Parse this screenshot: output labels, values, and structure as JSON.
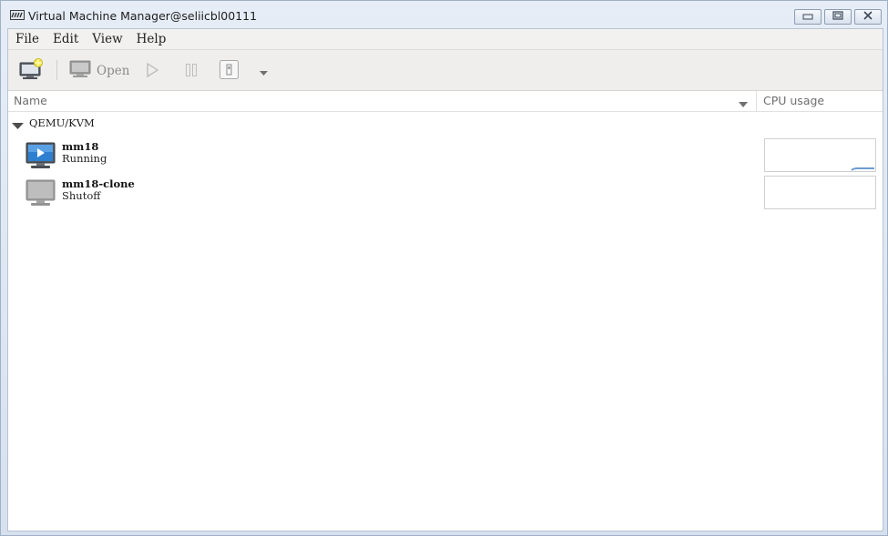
{
  "window": {
    "title": "Virtual Machine Manager@seliicbl00111",
    "app_icon": "vmm-app-icon",
    "controls": [
      "minimize-icon",
      "maximize-icon",
      "close-icon"
    ]
  },
  "menubar": {
    "items": [
      "File",
      "Edit",
      "View",
      "Help"
    ]
  },
  "toolbar": {
    "new_vm_icon": "new-vm-icon",
    "open_label": "Open",
    "run_icon": "play-icon",
    "pause_icon": "pause-icon",
    "shutdown_icon": "shutdown-icon",
    "shutdown_menu_icon": "chevron-down-icon"
  },
  "list_header": {
    "name_label": "Name",
    "cpu_label": "CPU usage"
  },
  "connection": {
    "label": "QEMU/KVM",
    "expanded": true
  },
  "vms": [
    {
      "name": "mm18",
      "status": "Running",
      "icon": "running-vm-icon",
      "cpu_usage": 0.05
    },
    {
      "name": "mm18-clone",
      "status": "Shutoff",
      "icon": "shutoff-vm-icon",
      "cpu_usage": 0
    }
  ],
  "colors": {
    "accent": "#3b7fc4",
    "graph_line": "#6d9ecf"
  }
}
